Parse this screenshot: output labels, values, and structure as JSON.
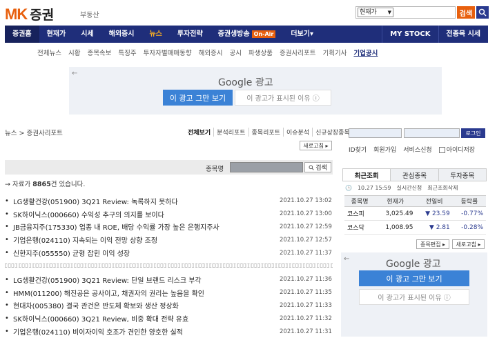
{
  "header": {
    "logo_mk": "MK",
    "logo_sec": "증권",
    "logo_sub": "부동산",
    "search_select": "현재가",
    "search_button": "검색"
  },
  "mainnav": {
    "items": [
      "증권홈",
      "현재가",
      "시세",
      "해외증시",
      "뉴스",
      "투자전략",
      "증권생방송"
    ],
    "onair": "On-Air",
    "more": "더보기",
    "right": [
      "MY STOCK",
      "전종목 시세"
    ]
  },
  "subnav": [
    "전체뉴스",
    "시황",
    "종목속보",
    "특징주",
    "투자자별매매동향",
    "해외증시",
    "공시",
    "파생상품",
    "증권사리포트",
    "기획기사",
    "기업공시"
  ],
  "ad": {
    "label": "Google 광고",
    "stop": "이 광고 그만 보기",
    "why": "이 광고가 표시된 이유 ⓘ"
  },
  "breadcrumb": "뉴스 > 증권사리포트",
  "tabs": [
    "전체보기",
    "분석리포트",
    "종목리포트",
    "이슈분석",
    "신규상장종목"
  ],
  "refresh": "새로고침 ▸",
  "stock_search": {
    "label": "종목명",
    "button": "검색"
  },
  "count": {
    "prefix": "→ 자료가 ",
    "number": "8865",
    "suffix": "건 있습니다."
  },
  "list1": [
    {
      "title": "LG생활건강(051900) 3Q21 Review: 녹록하지 못하다",
      "date": "2021.10.27 13:02"
    },
    {
      "title": "SK하이닉스(000660) 수익성 추구의 의지를 보이다",
      "date": "2021.10.27 13:00"
    },
    {
      "title": "JB금융지주(175330) 업종 내 ROE, 배당 수익률 가장 높은 은행지주사",
      "date": "2021.10.27 12:59"
    },
    {
      "title": "기업은행(024110) 지속되는 이익 전망 상향 조정",
      "date": "2021.10.27 12:57"
    },
    {
      "title": "신한지주(055550) 균형 잡힌 이익 성장",
      "date": "2021.10.27 11:37"
    }
  ],
  "list2": [
    {
      "title": "LG생활건강(051900) 3Q21 Review: 단일 브랜드 리스크 부각",
      "date": "2021.10.27 11:36"
    },
    {
      "title": "HMM(011200) 해진공은 공사이고, 채권자의 권리는 높음을 확인",
      "date": "2021.10.27 11:35"
    },
    {
      "title": "현대차(005380) 결국 관건은 반도체 확보와 생산 정상화",
      "date": "2021.10.27 11:33"
    },
    {
      "title": "SK하이닉스(000660) 3Q21 Review, 비중 확대 전략 유효",
      "date": "2021.10.27 11:32"
    },
    {
      "title": "기업은행(024110) 비이자이익 호조가 견인한 양호한 실적",
      "date": "2021.10.27 11:31"
    }
  ],
  "login": {
    "button": "로그인",
    "links": [
      "ID찾기",
      "회원가입",
      "서비스신청"
    ],
    "save_id": "아이디저장"
  },
  "rtabs": [
    "최근조회",
    "관심종목",
    "투자종목"
  ],
  "rstatus": {
    "time": "10.27 15:59",
    "realtime": "실시간신청",
    "clear": "최근조회삭제"
  },
  "market_table": {
    "headers": [
      "종목명",
      "현재가",
      "전일비",
      "등락률"
    ],
    "rows": [
      {
        "name": "코스피",
        "price": "3,025.49",
        "change": "▼ 23.59",
        "rate": "-0.77%"
      },
      {
        "name": "코스닥",
        "price": "1,008.95",
        "change": "▼ 2.81",
        "rate": "-0.28%"
      }
    ]
  },
  "edit_button": "종목편집 ▸",
  "refresh2": "새로고침 ▸",
  "colors": {
    "brand_orange": "#e8600e",
    "nav_blue": "#1f2e7a",
    "ad_blue": "#3b82d6",
    "down_blue": "#2a3a8f"
  }
}
